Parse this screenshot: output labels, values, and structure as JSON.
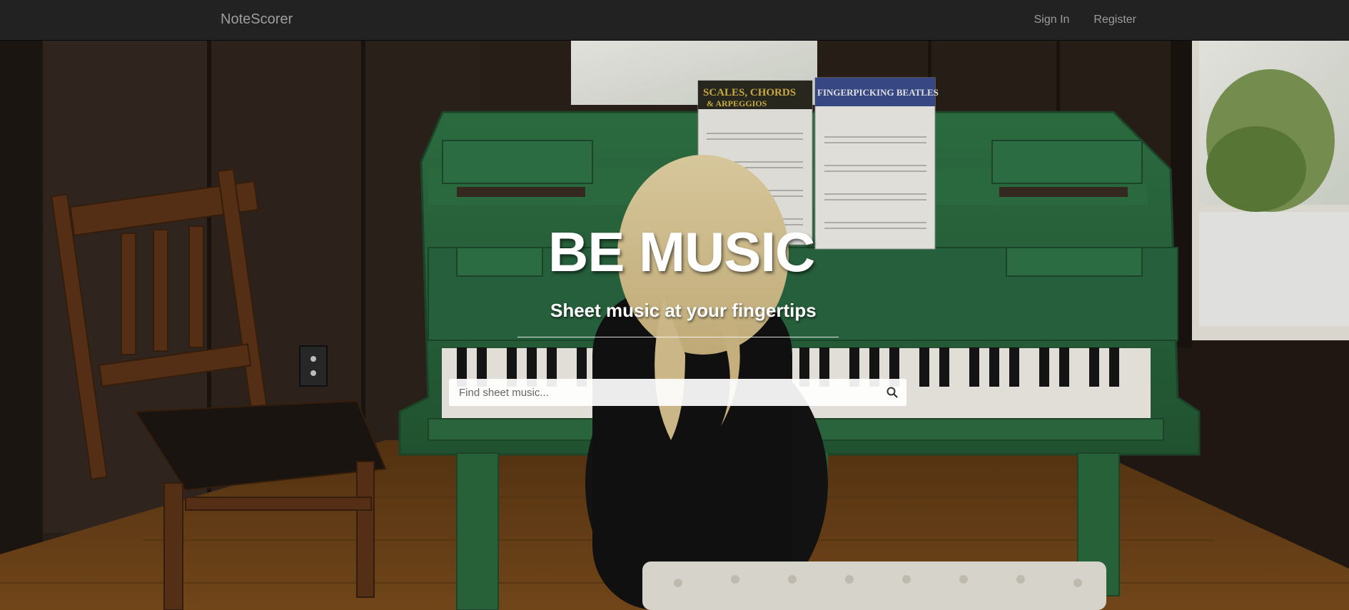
{
  "navbar": {
    "brand": "NoteScorer",
    "links": [
      "Sign In",
      "Register"
    ]
  },
  "hero": {
    "title": "BE MUSIC",
    "subtitle": "Sheet music at your fingertips",
    "search": {
      "placeholder": "Find sheet music...",
      "value": ""
    },
    "books": {
      "left_title_line1": "SCALES, CHORDS",
      "left_title_line2": "& ARPEGGIOS",
      "right_title": "FINGERPICKING BEATLES"
    }
  },
  "icons": {
    "search": "search-icon"
  },
  "colors": {
    "navbar_bg": "#222222",
    "nav_text": "#9d9d9d",
    "piano_green": "#2e6b3f",
    "floor": "#6b4218"
  }
}
